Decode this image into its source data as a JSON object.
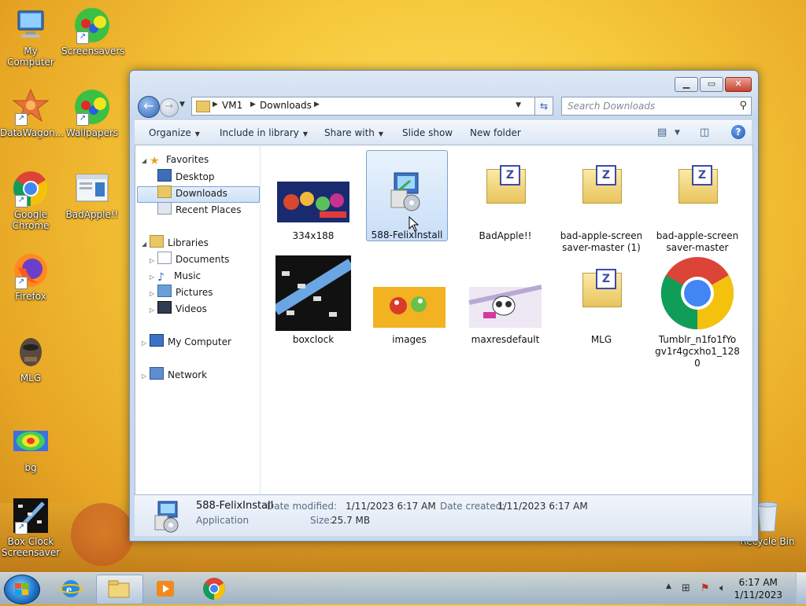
{
  "desktop": {
    "icons": [
      {
        "label": "My Computer"
      },
      {
        "label": "Screensavers"
      },
      {
        "label": "DataWagon..."
      },
      {
        "label": "Wallpapers"
      },
      {
        "label": "Google Chrome"
      },
      {
        "label": "BadApple!!"
      },
      {
        "label": "Firefox"
      },
      {
        "label": "MLG"
      },
      {
        "label": "bg"
      },
      {
        "label": "Box Clock Screensaver"
      },
      {
        "label": "Recycle Bin"
      }
    ]
  },
  "window": {
    "address": {
      "segments": [
        "VM1",
        "Downloads"
      ]
    },
    "search_placeholder": "Search Downloads",
    "toolbar": {
      "organize": "Organize",
      "include": "Include in library",
      "share": "Share with",
      "slideshow": "Slide show",
      "newfolder": "New folder"
    },
    "nav": {
      "favorites": "Favorites",
      "desktop": "Desktop",
      "downloads": "Downloads",
      "recent": "Recent Places",
      "libraries": "Libraries",
      "documents": "Documents",
      "music": "Music",
      "pictures": "Pictures",
      "videos": "Videos",
      "computer": "My Computer",
      "network": "Network"
    },
    "files": [
      {
        "name": "334x188"
      },
      {
        "name": "588-FelixInstall"
      },
      {
        "name": "BadApple!!"
      },
      {
        "name": "bad-apple-screen saver-master (1)"
      },
      {
        "name": "bad-apple-screen saver-master"
      },
      {
        "name": "boxclock"
      },
      {
        "name": "images"
      },
      {
        "name": "maxresdefault"
      },
      {
        "name": "MLG"
      },
      {
        "name": "Tumblr_n1fo1fYo gv1r4gcxho1_128 0"
      }
    ],
    "details": {
      "name": "588-FelixInstall",
      "type": "Application",
      "modified_label": "Date modified:",
      "modified": "1/11/2023 6:17 AM",
      "created_label": "Date created:",
      "created": "1/11/2023 6:17 AM",
      "size_label": "Size:",
      "size": "25.7 MB"
    }
  },
  "taskbar": {
    "time": "6:17 AM",
    "date": "1/11/2023"
  },
  "colors": {
    "accent": "#2d63b5",
    "desktop": "#f6c83a"
  }
}
